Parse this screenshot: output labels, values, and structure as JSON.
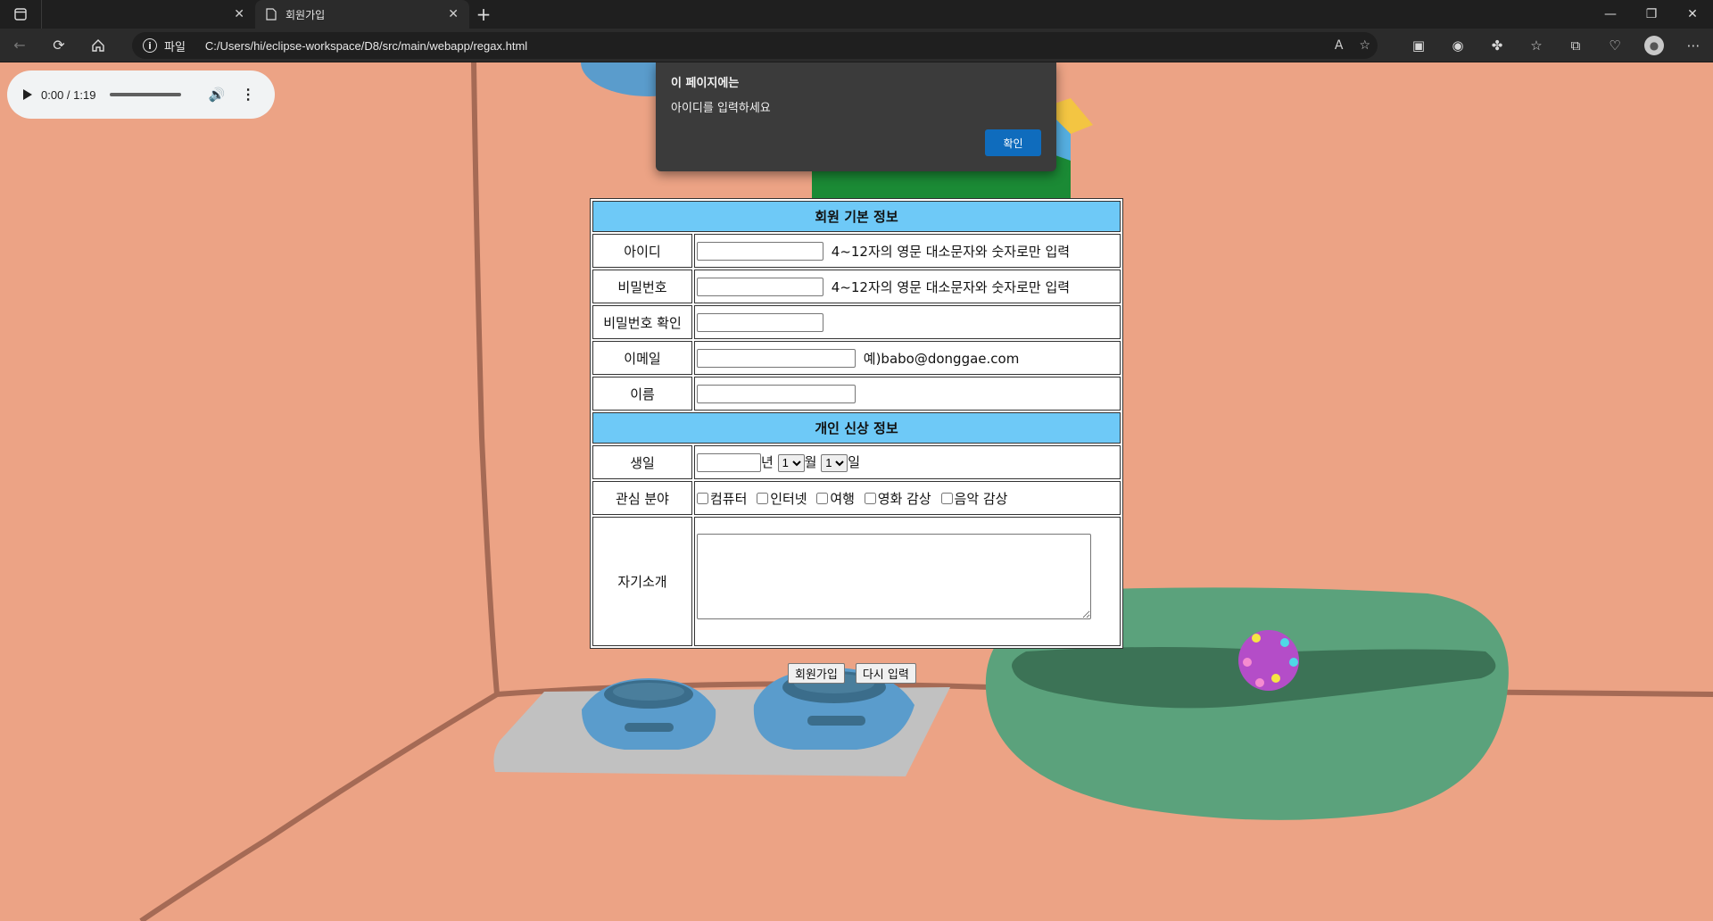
{
  "browser": {
    "tabs": [
      {
        "title": "",
        "active": false
      },
      {
        "title": "회원가입",
        "active": true
      }
    ],
    "address": {
      "scheme_label": "파일",
      "url": "C:/Users/hi/eclipse-workspace/D8/src/main/webapp/regax.html"
    }
  },
  "audio": {
    "time": "0:00 / 1:19"
  },
  "dialog": {
    "title": "이 페이지에는",
    "message": "아이디를 입력하세요",
    "ok_label": "확인"
  },
  "form": {
    "section1_title": "회원 기본 정보",
    "section2_title": "개인 신상 정보",
    "id_label": "아이디",
    "id_hint": "4~12자의 영문 대소문자와 숫자로만 입력",
    "pw_label": "비밀번호",
    "pw_hint": "4~12자의 영문 대소문자와 숫자로만 입력",
    "pw_confirm_label": "비밀번호 확인",
    "email_label": "이메일",
    "email_hint": "예)babo@donggae.com",
    "name_label": "이름",
    "birth_label": "생일",
    "year_suffix": "년",
    "month_value": "1",
    "month_suffix": "월",
    "day_value": "1",
    "day_suffix": "일",
    "interest_label": "관심 분야",
    "interests": [
      "컴퓨터",
      "인터넷",
      "여행",
      "영화 감상",
      "음악 감상"
    ],
    "intro_label": "자기소개",
    "submit_label": "회원가입",
    "reset_label": "다시 입력"
  },
  "colors": {
    "wall": "#eca385",
    "header_bg": "#6ec9f7",
    "dialog_button": "#0f6cbd"
  }
}
